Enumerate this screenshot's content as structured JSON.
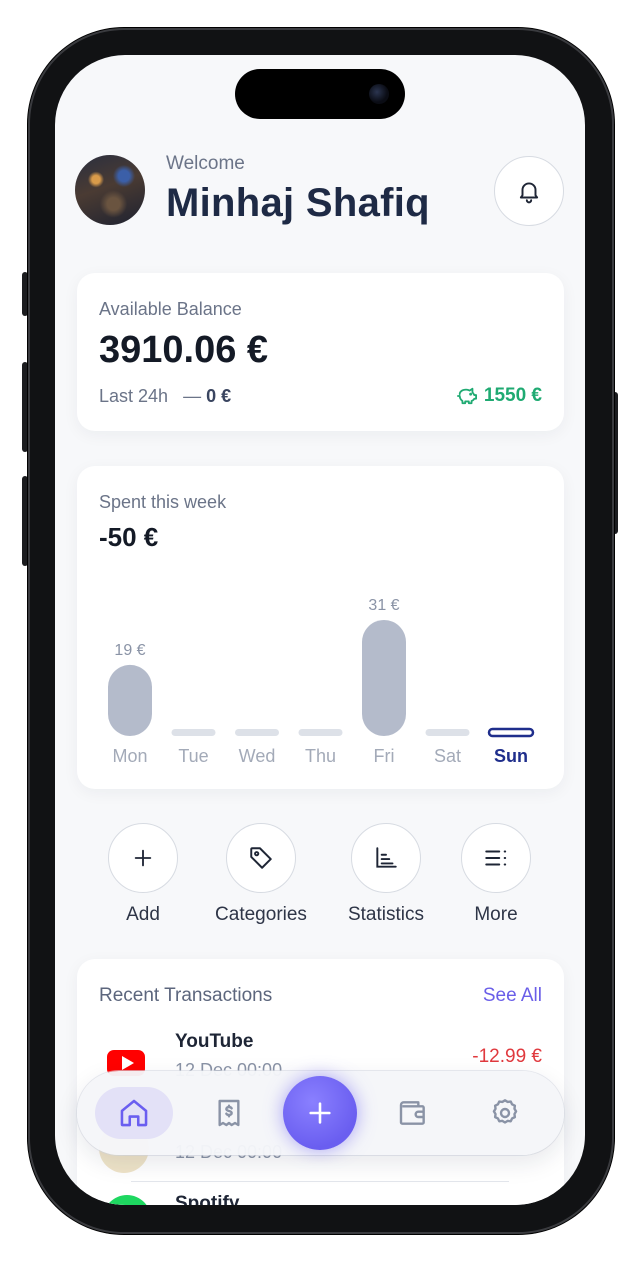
{
  "header": {
    "welcome": "Welcome",
    "username": "Minhaj Shafiq"
  },
  "balance": {
    "label": "Available Balance",
    "value": "3910.06 €",
    "last24_label": "Last 24h",
    "last24_dash": "—",
    "last24_value": "0 €",
    "savings_value": "1550 €"
  },
  "spent": {
    "label": "Spent this week",
    "value": "-50 €"
  },
  "chart_data": {
    "type": "bar",
    "categories": [
      "Mon",
      "Tue",
      "Wed",
      "Thu",
      "Fri",
      "Sat",
      "Sun"
    ],
    "values": [
      19,
      0,
      0,
      0,
      31,
      0,
      0
    ],
    "data_labels": [
      "19 €",
      "",
      "",
      "",
      "31 €",
      "",
      ""
    ],
    "selected": "Sun",
    "ylim": [
      0,
      31
    ]
  },
  "quick_actions": [
    {
      "label": "Add",
      "icon": "plus-icon"
    },
    {
      "label": "Categories",
      "icon": "tag-icon"
    },
    {
      "label": "Statistics",
      "icon": "chart-icon"
    },
    {
      "label": "More",
      "icon": "menu-icon"
    }
  ],
  "transactions": {
    "title": "Recent Transactions",
    "see_all": "See All",
    "items": [
      {
        "name": "YouTube",
        "date": "12 Dec 00:00",
        "amount": "-12.99 €",
        "icon": "youtube-logo-icon"
      },
      {
        "name": "",
        "date": "12 Dec 00:00",
        "amount": "",
        "icon": "merchant-logo-icon"
      },
      {
        "name": "Spotify",
        "date": "",
        "amount": "",
        "icon": "spotify-logo-icon"
      }
    ]
  },
  "colors": {
    "accent": "#6a5ef0",
    "positive": "#1faa72",
    "negative": "#e0393e",
    "bar": "#b4bbcb",
    "selected_day": "#1f2e8c"
  },
  "nav": [
    "home-icon",
    "receipt-icon",
    "add-icon",
    "wallet-icon",
    "settings-icon"
  ]
}
